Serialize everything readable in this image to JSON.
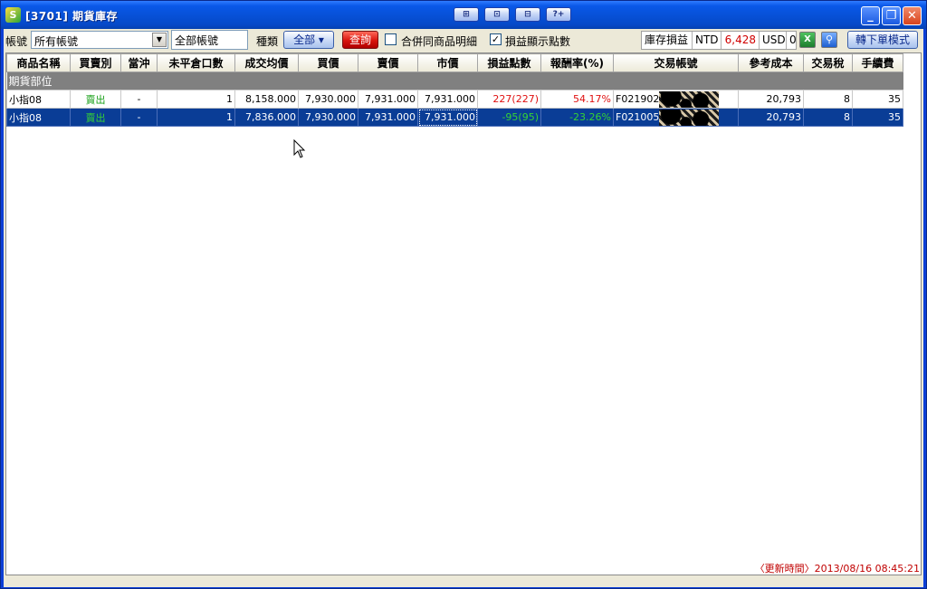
{
  "window": {
    "title": "[3701] 期貨庫存",
    "app_icon_letter": "S",
    "title_tools": [
      "⊞",
      "⊡",
      "⊟",
      "?+"
    ],
    "controls": {
      "minimize": "_",
      "restore": "❐",
      "close": "✕"
    }
  },
  "toolbar": {
    "account_label": "帳號",
    "account_select": "所有帳號",
    "account_name": "全部帳號",
    "type_label": "種類",
    "type_button": "全部 ▾",
    "query_button": "查詢",
    "merge_checkbox": {
      "label": "合併同商品明細",
      "checked": false
    },
    "points_checkbox": {
      "label": "損益顯示點數",
      "checked": true
    },
    "inventory_pl_label": "庫存損益",
    "ntd_label": "NTD",
    "ntd_value": "6,428",
    "usd_label": "USD",
    "usd_value": "0",
    "switch_mode_button": "轉下單模式"
  },
  "grid": {
    "columns": [
      "商品名稱",
      "買賣別",
      "當沖",
      "未平倉口數",
      "成交均價",
      "買價",
      "賣價",
      "市價",
      "損益點數",
      "報酬率(%)",
      "交易帳號",
      "參考成本",
      "交易稅",
      "手續費"
    ],
    "group_label": "期貨部位",
    "rows": [
      {
        "product": "小指08",
        "side": "賣出",
        "daytrade": "-",
        "open_qty": "1",
        "avg_price": "8,158.000",
        "bid": "7,930.000",
        "ask": "7,931.000",
        "market": "7,931.000",
        "pl_points": "227(227)",
        "return": "54.17%",
        "account": "F021902",
        "cost": "20,793",
        "tax": "8",
        "fee": "35",
        "pl_color": "red",
        "selected": false
      },
      {
        "product": "小指08",
        "side": "賣出",
        "daytrade": "-",
        "open_qty": "1",
        "avg_price": "7,836.000",
        "bid": "7,930.000",
        "ask": "7,931.000",
        "market": "7,931.000",
        "pl_points": "-95(95)",
        "return": "-23.26%",
        "account": "F021005",
        "cost": "20,793",
        "tax": "8",
        "fee": "35",
        "pl_color": "green",
        "selected": true
      }
    ]
  },
  "status": {
    "update_time": "〈更新時間〉2013/08/16 08:45:21"
  }
}
